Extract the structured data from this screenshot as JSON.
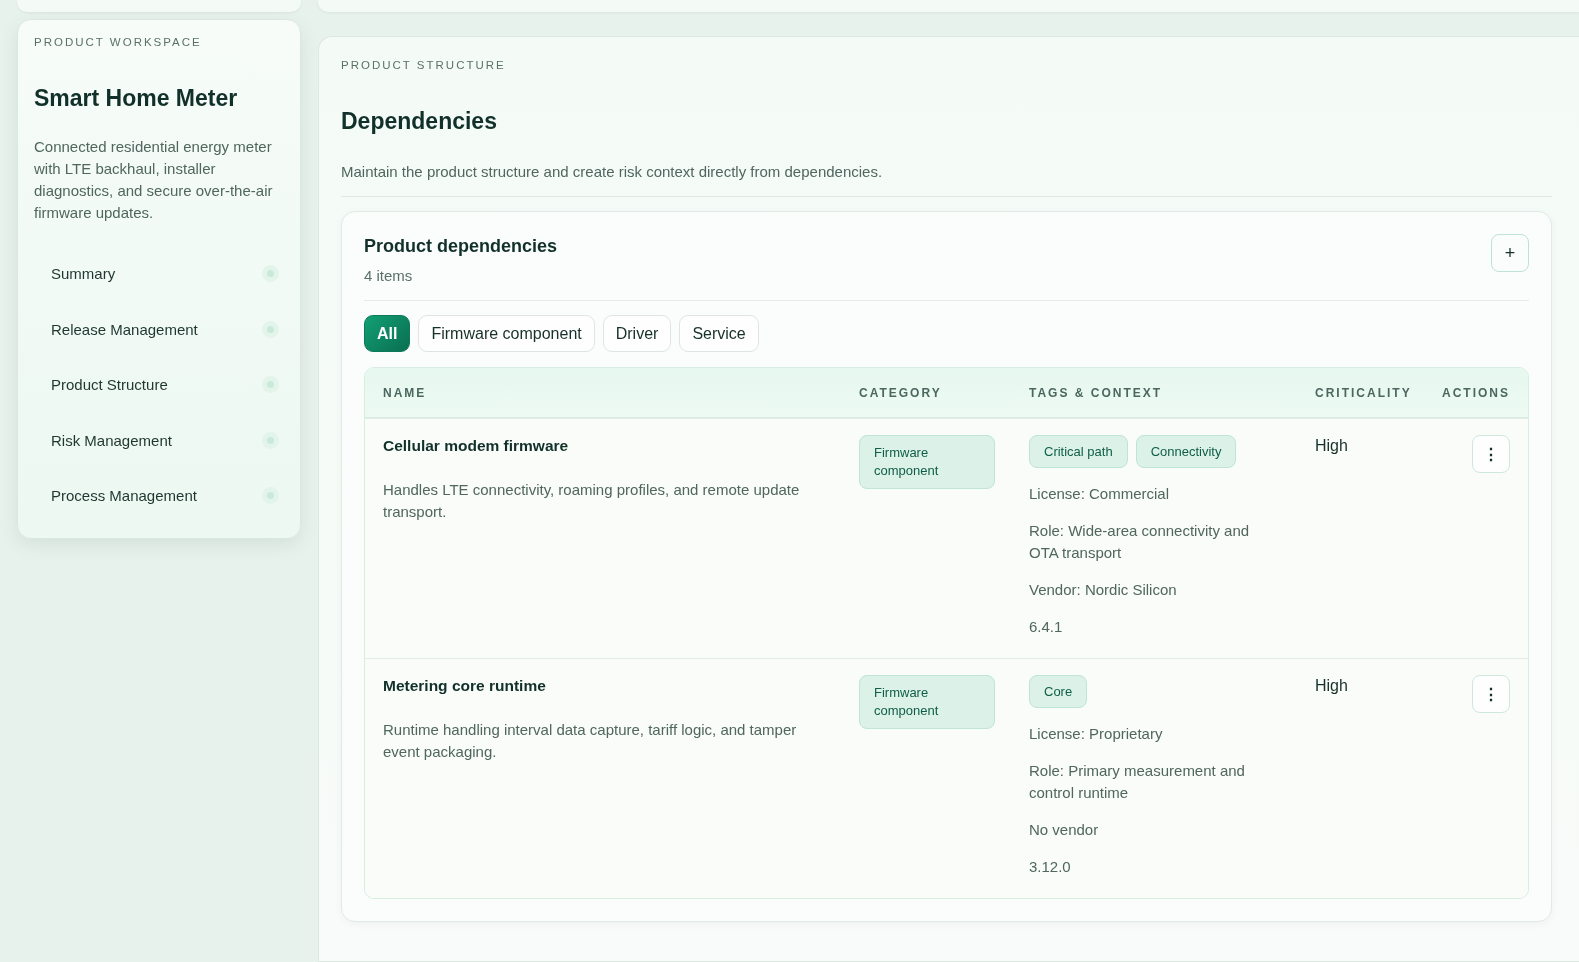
{
  "sidebar": {
    "eyebrow": "PRODUCT WORKSPACE",
    "title": "Smart Home Meter",
    "description": "Connected residential energy meter with LTE backhaul, installer diagnostics, and secure over-the-air firmware updates.",
    "items": [
      {
        "label": "Summary"
      },
      {
        "label": "Release Management"
      },
      {
        "label": "Product Structure"
      },
      {
        "label": "Risk Management"
      },
      {
        "label": "Process Management"
      }
    ]
  },
  "main": {
    "eyebrow": "PRODUCT STRUCTURE",
    "title": "Dependencies",
    "description": "Maintain the product structure and create risk context directly from dependencies.",
    "card": {
      "title": "Product dependencies",
      "count": "4 items",
      "add_button": "+",
      "filters": [
        {
          "label": "All",
          "selected": true
        },
        {
          "label": "Firmware component",
          "selected": false
        },
        {
          "label": "Driver",
          "selected": false
        },
        {
          "label": "Service",
          "selected": false
        }
      ],
      "table": {
        "columns": [
          "NAME",
          "CATEGORY",
          "TAGS & CONTEXT",
          "CRITICALITY",
          "ACTIONS"
        ],
        "rows": [
          {
            "name": "Cellular modem firmware",
            "description": "Handles LTE connectivity, roaming profiles, and remote update transport.",
            "category": "Firmware component",
            "tags": [
              "Critical path",
              "Connectivity"
            ],
            "context": [
              "License: Commercial",
              "Role: Wide-area connectivity and OTA transport",
              "Vendor: Nordic Silicon",
              "6.4.1"
            ],
            "criticality": "High",
            "action": "⋮"
          },
          {
            "name": "Metering core runtime",
            "description": "Runtime handling interval data capture, tariff logic, and tamper event packaging.",
            "category": "Firmware component",
            "tags": [
              "Core"
            ],
            "context": [
              "License: Proprietary",
              "Role: Primary measurement and control runtime",
              "No vendor",
              "3.12.0"
            ],
            "criticality": "High",
            "action": "⋮"
          }
        ]
      }
    }
  }
}
